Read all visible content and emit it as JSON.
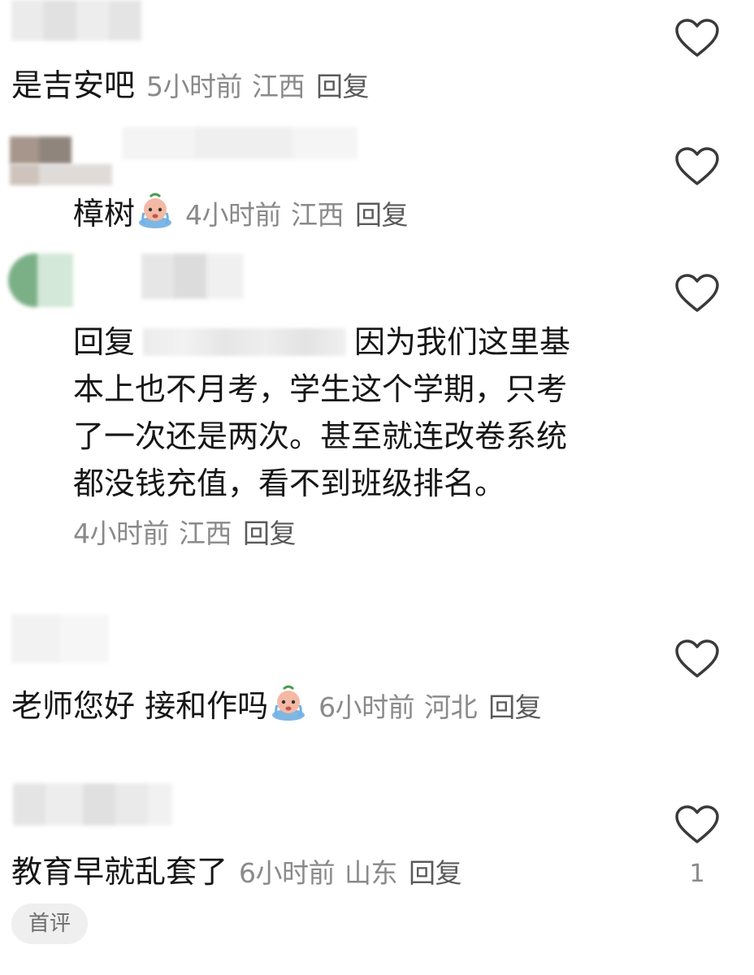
{
  "comments": [
    {
      "text": "是吉安吧",
      "time": "5小时前",
      "location": "江西",
      "reply": "回复"
    },
    {
      "text": "樟树",
      "sticker": "crying-sticker",
      "time": "4小时前",
      "location": "江西",
      "reply": "回复"
    },
    {
      "reply_prefix": "回复",
      "lines": [
        "因为我们这里基",
        "本上也不月考，学生这个学期，只考",
        "了一次还是两次。甚至就连改卷系统",
        "都没钱充值，看不到班级排名。"
      ],
      "time": "4小时前",
      "location": "江西",
      "reply": "回复"
    },
    {
      "text": "老师您好 接和作吗",
      "sticker": "crying-sticker",
      "time": "6小时前",
      "location": "河北",
      "reply": "回复"
    },
    {
      "text": "教育早就乱套了",
      "time": "6小时前",
      "location": "山东",
      "reply": "回复",
      "likes": "1",
      "tag": "首评"
    }
  ],
  "icons": {
    "like": "heart-outline-icon",
    "sticker": "crying-sticker"
  },
  "colors": {
    "text": "#161616",
    "meta": "#8a8a8a",
    "icon": "#3a3a3a",
    "tag_bg": "#efefef"
  }
}
